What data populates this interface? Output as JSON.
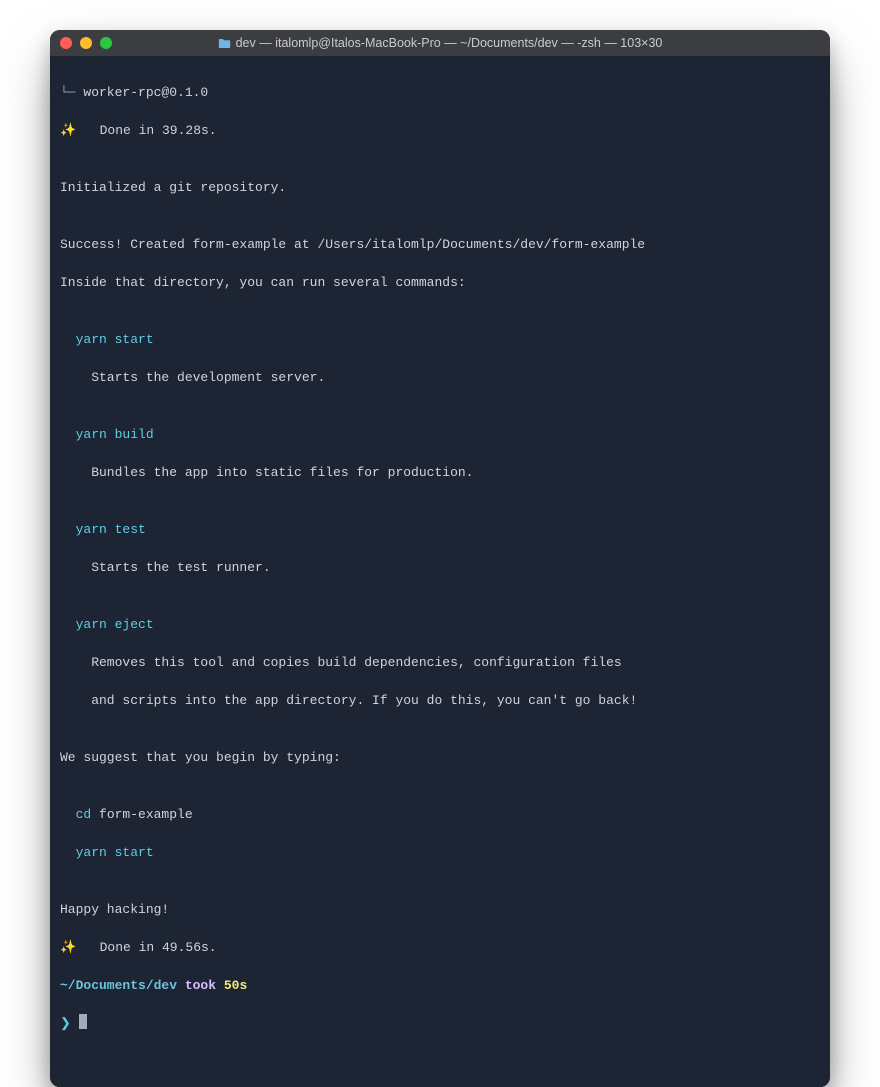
{
  "titlebar": {
    "title": "dev — italomlp@Italos-MacBook-Pro — ~/Documents/dev — -zsh — 103×30"
  },
  "lines": {
    "worker": "worker-rpc@0.1.0",
    "done1_prefix": "✨   ",
    "done1": "Done in 39.28s.",
    "blank": "",
    "init": "Initialized a git repository.",
    "success": "Success! Created form-example at /Users/italomlp/Documents/dev/form-example",
    "inside": "Inside that directory, you can run several commands:",
    "yarn_start": "  yarn start",
    "yarn_start_desc": "    Starts the development server.",
    "yarn_build": "  yarn build",
    "yarn_build_desc": "    Bundles the app into static files for production.",
    "yarn_test": "  yarn test",
    "yarn_test_desc": "    Starts the test runner.",
    "yarn_eject": "  yarn eject",
    "yarn_eject_desc1": "    Removes this tool and copies build dependencies, configuration files",
    "yarn_eject_desc2": "    and scripts into the app directory. If you do this, you can't go back!",
    "suggest": "We suggest that you begin by typing:",
    "cd_pre": "  cd ",
    "cd_arg": "form-example",
    "ystart2": "  yarn start",
    "happy": "Happy hacking!",
    "done2_prefix": "✨   ",
    "done2": "Done in 49.56s.",
    "prompt_path": "~/Documents/dev ",
    "took_label": "took ",
    "took_value": "50s",
    "prompt_arrow": "❯ "
  }
}
